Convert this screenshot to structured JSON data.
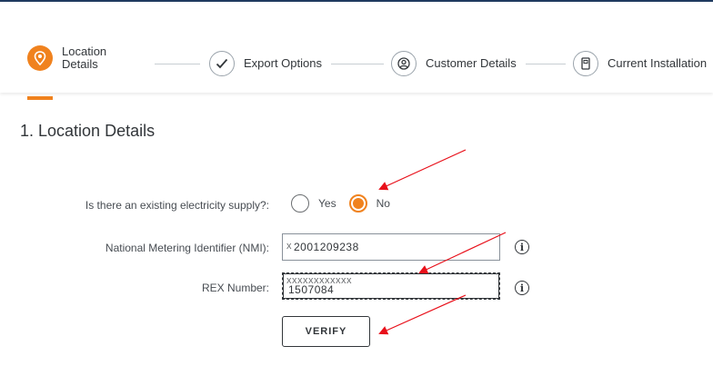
{
  "stepper": {
    "steps": [
      {
        "label_line1": "Location",
        "label_line2": "Details",
        "state": "active",
        "icon": "location-pin-icon"
      },
      {
        "label": "Export Options",
        "state": "complete",
        "icon": "checkmark-icon"
      },
      {
        "label": "Customer Details",
        "state": "idle",
        "icon": "user-circle-icon"
      },
      {
        "label": "Current Installation",
        "state": "idle",
        "icon": "meter-icon"
      }
    ]
  },
  "section": {
    "title": "1. Location Details"
  },
  "form": {
    "supply_question": "Is there an existing electricity supply?:",
    "supply_options": [
      {
        "label": "Yes",
        "selected": false
      },
      {
        "label": "No",
        "selected": true
      }
    ],
    "nmi_label": "National Metering Identifier (NMI):",
    "nmi_value": "2001209238",
    "nmi_overlay": "x",
    "rex_label": "REX Number:",
    "rex_value": "1507084",
    "rex_overlay": "xxxxxxxxxxxx",
    "verify_label": "VERIFY"
  },
  "colors": {
    "accent": "#f0821e",
    "arrow": "#e8101a",
    "text": "#32363a"
  }
}
